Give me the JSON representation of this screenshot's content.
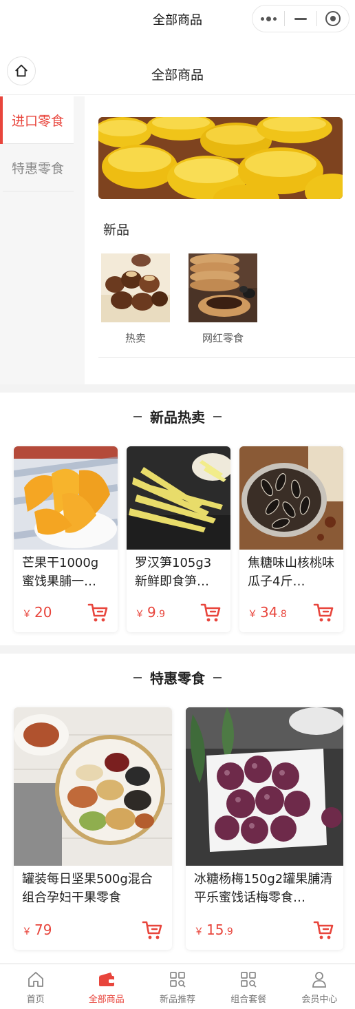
{
  "titlebar": {
    "title": "全部商品"
  },
  "page_header": {
    "title": "全部商品"
  },
  "sidebar": {
    "items": [
      {
        "label": "进口零食",
        "active": true
      },
      {
        "label": "特惠零食",
        "active": false
      }
    ]
  },
  "category": {
    "sub_title": "新品",
    "subcategories": [
      {
        "label": "热卖",
        "icon": "chestnut-image"
      },
      {
        "label": "网红零食",
        "icon": "cookie-image"
      }
    ]
  },
  "section_hot": {
    "title": "新品热卖",
    "products": [
      {
        "name": "芒果干1000g蜜饯果脯一…",
        "currency": "￥",
        "price_int": "20",
        "price_dec": ""
      },
      {
        "name": "罗汉笋105g3新鲜即食笋…",
        "currency": "￥",
        "price_int": "9",
        "price_dec": ".9"
      },
      {
        "name": "焦糖味山核桃味瓜子4斤…",
        "currency": "￥",
        "price_int": "34",
        "price_dec": ".8"
      }
    ]
  },
  "section_sale": {
    "title": "特惠零食",
    "products": [
      {
        "name": "罐装每日坚果500g混合组合孕妇干果零食",
        "currency": "￥",
        "price_int": "79",
        "price_dec": ""
      },
      {
        "name": "冰糖杨梅150g2罐果脯清平乐蜜饯话梅零食…",
        "currency": "￥",
        "price_int": "15",
        "price_dec": ".9"
      }
    ]
  },
  "tabbar": {
    "items": [
      {
        "label": "首页",
        "icon": "home-icon",
        "active": false
      },
      {
        "label": "全部商品",
        "icon": "wallet-icon",
        "active": true
      },
      {
        "label": "新品推荐",
        "icon": "grid-search-icon",
        "active": false
      },
      {
        "label": "组合套餐",
        "icon": "grid-search-icon",
        "active": false
      },
      {
        "label": "会员中心",
        "icon": "user-icon",
        "active": false
      }
    ]
  },
  "colors": {
    "accent": "#e8453c",
    "divider": "#eeeeee",
    "sidebar_bg": "#f6f6f6"
  }
}
